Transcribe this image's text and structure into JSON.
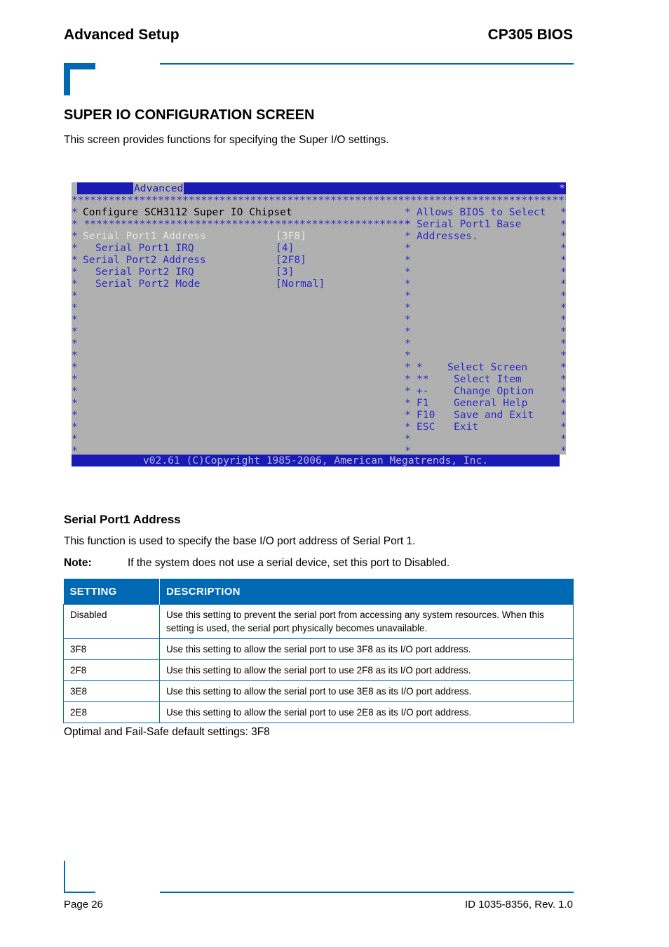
{
  "header": {
    "left": "Advanced Setup",
    "right": "CP305 BIOS"
  },
  "section": {
    "title": "SUPER IO CONFIGURATION SCREEN",
    "intro": "This screen provides functions for specifying the Super I/O settings."
  },
  "bios": {
    "tab": "Advanced",
    "screen_title": "Configure SCH3112 Super IO Chipset",
    "items": [
      {
        "label": "Serial Port1 Address",
        "value": "[3F8]",
        "selected": true,
        "indent": false
      },
      {
        "label": "Serial Port1 IRQ",
        "value": "[4]",
        "selected": false,
        "indent": true
      },
      {
        "label": "Serial Port2 Address",
        "value": "[2F8]",
        "selected": false,
        "indent": false
      },
      {
        "label": "Serial Port2 IRQ",
        "value": "[3]",
        "selected": false,
        "indent": true
      },
      {
        "label": "Serial Port2 Mode",
        "value": "[Normal]",
        "selected": false,
        "indent": true
      }
    ],
    "help": [
      "Allows BIOS to Select",
      "Serial Port1 Base",
      "Addresses."
    ],
    "keys": [
      {
        "key": "*",
        "action": "Select Screen"
      },
      {
        "key": "**",
        "action": "Select Item"
      },
      {
        "key": "+-",
        "action": "Change Option"
      },
      {
        "key": "F1",
        "action": "General Help"
      },
      {
        "key": "F10",
        "action": "Save and Exit"
      },
      {
        "key": "ESC",
        "action": "Exit"
      }
    ],
    "footer": "v02.61 (C)Copyright 1985-2006, American Megatrends, Inc."
  },
  "subsection": {
    "title": "Serial Port1 Address",
    "text": "This function is used to specify the base I/O port address of Serial Port 1.",
    "note_label": "Note:",
    "note_text": "If the system does not use a serial device, set this port to Disabled."
  },
  "table": {
    "headers": [
      "SETTING",
      "DESCRIPTION"
    ],
    "rows": [
      [
        "Disabled",
        "Use this setting to prevent the serial port from accessing any system resources. When this setting is used, the serial port physically becomes unavailable."
      ],
      [
        "3F8",
        "Use this setting to allow the serial port to use 3F8 as its I/O port address."
      ],
      [
        "2F8",
        "Use this setting to allow the serial port to use 2F8 as its I/O port address."
      ],
      [
        "3E8",
        "Use this setting to allow the serial port to use 3E8 as its I/O port address."
      ],
      [
        "2E8",
        "Use this setting to allow the serial port to use 2E8 as its I/O port address."
      ]
    ]
  },
  "defaults_text": "Optimal and Fail-Safe default settings: 3F8",
  "footer": {
    "page": "Page 26",
    "id": "ID 1035-8356, Rev. 1.0"
  },
  "colors": {
    "accent": "#0069b4",
    "bios_bg": "#b0b0b0",
    "bios_blue": "#1a1ab4"
  }
}
